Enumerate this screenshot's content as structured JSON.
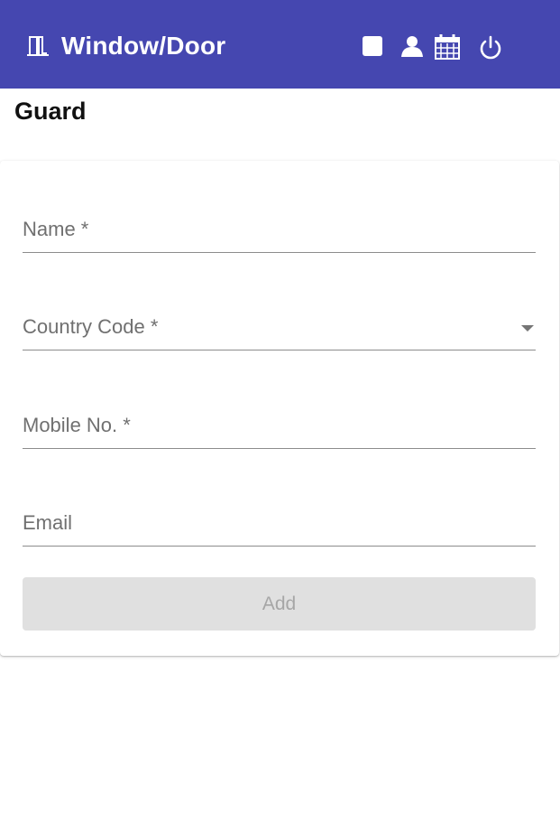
{
  "app": {
    "title": "Window/Door",
    "brand_color": "#4547b0",
    "brand_icon": "door-icon"
  },
  "header": {
    "actions": [
      {
        "name": "square-icon"
      },
      {
        "name": "user-icon"
      },
      {
        "name": "calendar-icon"
      },
      {
        "name": "power-icon"
      }
    ]
  },
  "page": {
    "title": "Guard"
  },
  "form": {
    "name_label": "Name *",
    "country_code_label": "Country Code *",
    "mobile_label": "Mobile No. *",
    "email_label": "Email",
    "add_label": "Add"
  }
}
